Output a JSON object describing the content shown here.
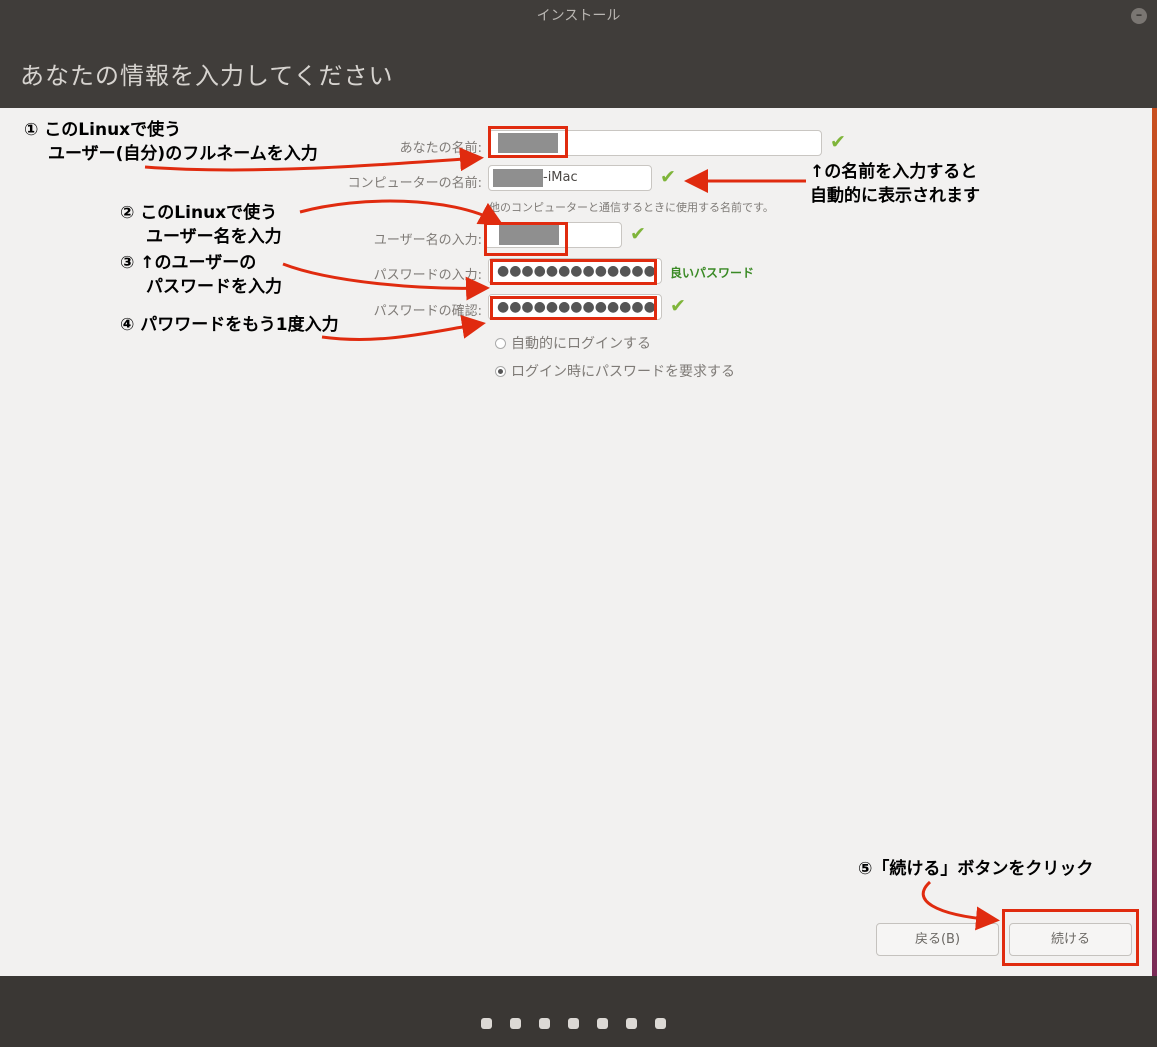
{
  "window": {
    "title": "インストール",
    "close_glyph": "–"
  },
  "header": {
    "title": "あなたの情報を入力してください"
  },
  "form": {
    "name_label": "あなたの名前:",
    "name_value": "",
    "computer_label": "コンピューターの名前:",
    "computer_value_suffix": "-iMac",
    "computer_hint": "他のコンピューターと通信するときに使用する名前です。",
    "username_label": "ユーザー名の入力:",
    "username_value": "",
    "password_label": "パスワードの入力:",
    "password_dots": "●●●●●●●●●●●●●",
    "password_strength": "良いパスワード",
    "confirm_label": "パスワードの確認:",
    "confirm_dots": "●●●●●●●●●●●●●",
    "check_glyph": "✔",
    "login_options": [
      {
        "label": "自動的にログインする",
        "selected": false
      },
      {
        "label": "ログイン時にパスワードを要求する",
        "selected": true
      }
    ]
  },
  "buttons": {
    "back": "戻る(B)",
    "continue": "続ける"
  },
  "progress": {
    "total_steps": 7
  },
  "annotations": {
    "note1_line1": "① このLinuxで使う",
    "note1_line2": "ユーザー(自分)のフルネームを入力",
    "note_auto_line1": "↑の名前を入力すると",
    "note_auto_line2": "自動的に表示されます",
    "note2_line1": "② このLinuxで使う",
    "note2_line2": "ユーザー名を入力",
    "note3_line1": "③ ↑のユーザーの",
    "note3_line2": "パスワードを入力",
    "note4": "④ パワワードをもう1度入力",
    "note5": "⑤「続ける」ボタンをクリック"
  },
  "colors": {
    "annotation_red": "#e02b0f",
    "check_green": "#7fb53a",
    "strength_green": "#3a8a25"
  }
}
